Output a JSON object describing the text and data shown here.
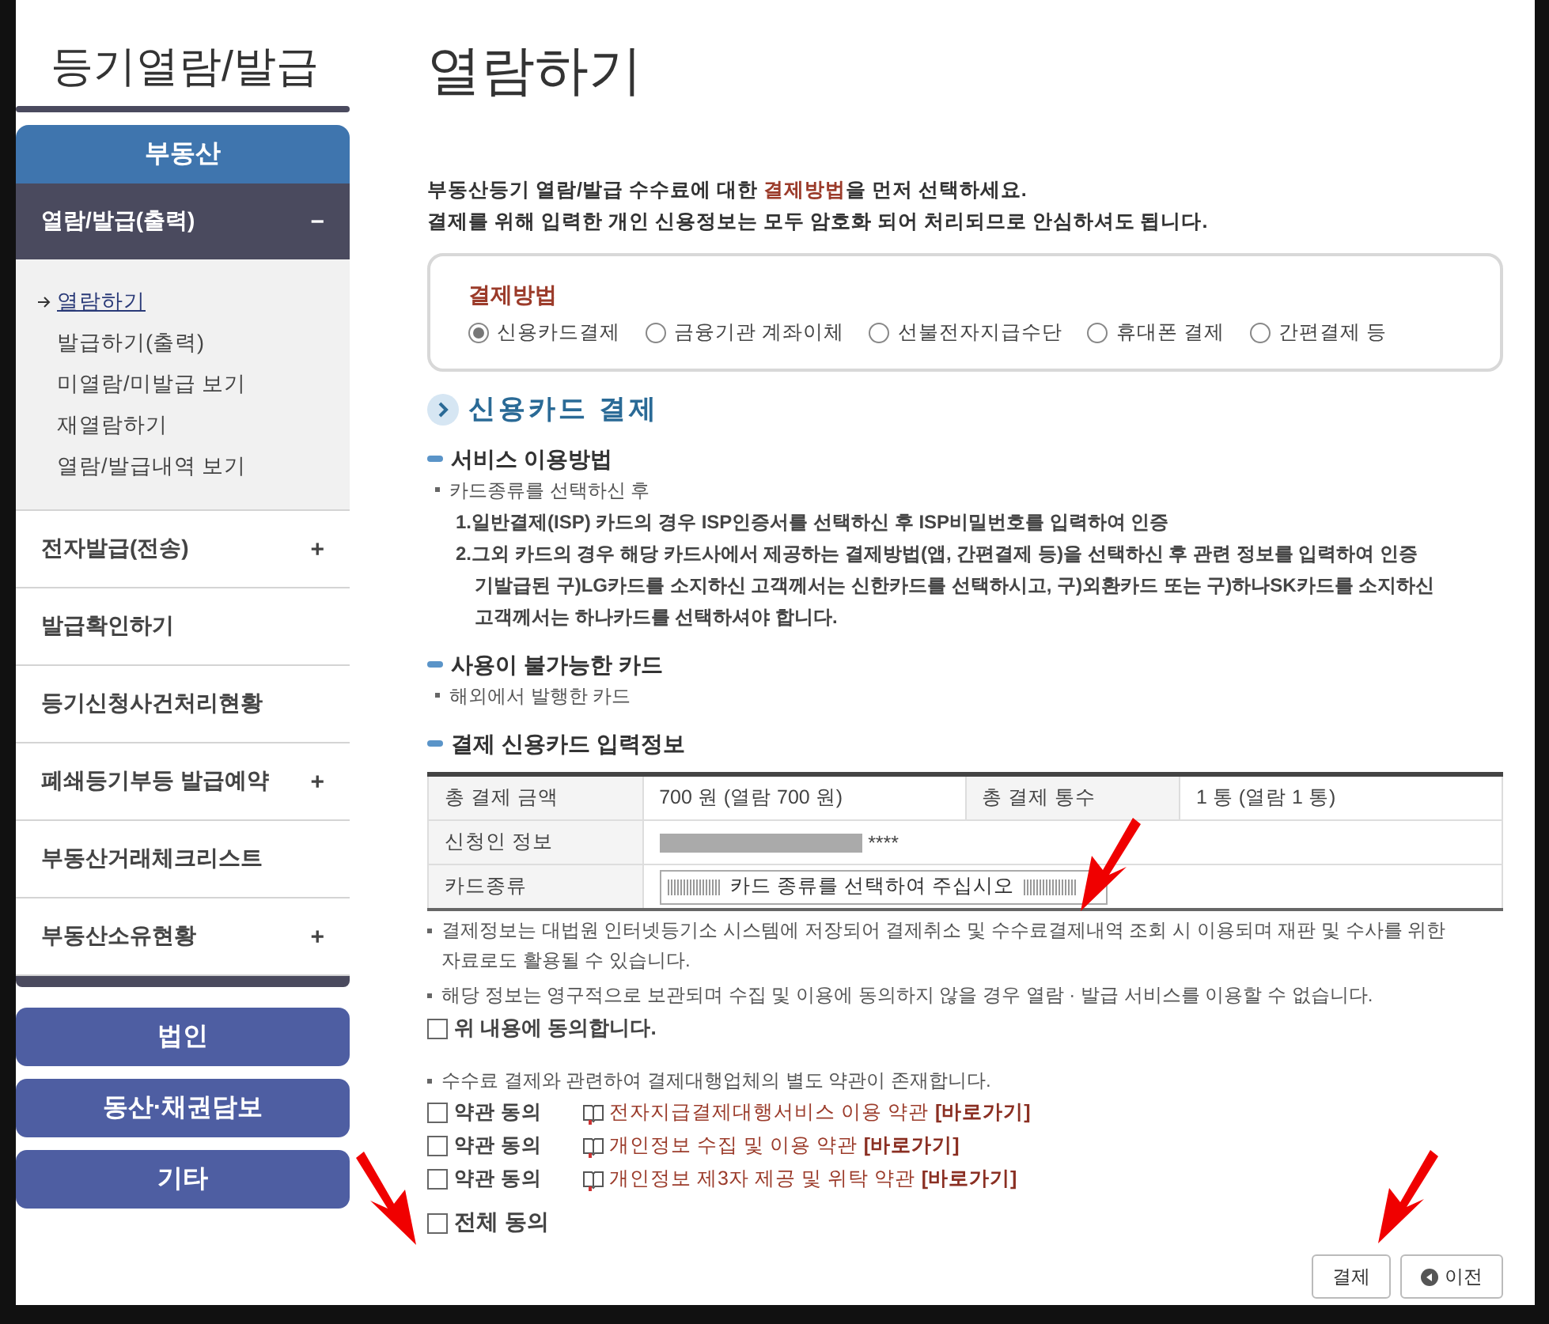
{
  "sidebar": {
    "title": "등기열람/발급",
    "section": "부동산",
    "items": [
      {
        "label": "열람/발급(출력)",
        "toggle": "−",
        "expanded": true,
        "children": [
          {
            "label": "열람하기",
            "selected": true
          },
          {
            "label": "발급하기(출력)",
            "selected": false
          },
          {
            "label": "미열람/미발급 보기",
            "selected": false
          },
          {
            "label": "재열람하기",
            "selected": false
          },
          {
            "label": "열람/발급내역 보기",
            "selected": false
          }
        ]
      },
      {
        "label": "전자발급(전송)",
        "toggle": "+",
        "expanded": false
      },
      {
        "label": "발급확인하기"
      },
      {
        "label": "등기신청사건처리현황"
      },
      {
        "label": "폐쇄등기부등 발급예약",
        "toggle": "+",
        "expanded": false
      },
      {
        "label": "부동산거래체크리스트"
      },
      {
        "label": "부동산소유현황",
        "toggle": "+",
        "expanded": false
      }
    ],
    "other_sections": [
      "법인",
      "동산·채권담보",
      "기타"
    ]
  },
  "page": {
    "title": "열람하기",
    "intro": [
      "부동산등기 열람/발급 수수료에 대한 **결제방법**을 먼저 선택하세요.",
      "결제를 위해 입력한 개인 신용정보는 모두 암호화 되어 처리되므로 안심하셔도 됩니다."
    ]
  },
  "payment_method": {
    "title": "결제방법",
    "options": [
      {
        "label": "신용카드결제",
        "selected": true
      },
      {
        "label": "금융기관 계좌이체",
        "selected": false
      },
      {
        "label": "선불전자지급수단",
        "selected": false
      },
      {
        "label": "휴대폰 결제",
        "selected": false
      },
      {
        "label": "간편결제 등",
        "selected": false
      }
    ]
  },
  "section_title": "신용카드 결제",
  "service": {
    "heading": "서비스 이용방법",
    "bullet": "카드종류를 선택하신 후",
    "steps": [
      "1.일반결제(ISP) 카드의 경우 ISP인증서를 선택하신 후 ISP비밀번호를 입력하여 인증",
      "2.그외 카드의 경우 해당 카드사에서 제공하는 결제방법(앱, 간편결제 등)을 선택하신 후 관련 정보를 입력하여 인증"
    ],
    "note": "기발급된 구)LG카드를 소지하신 고객께서는 신한카드를 선택하시고, 구)외환카드 또는 구)하나SK카드를 소지하신 고객께서는 하나카드를 선택하셔야 합니다."
  },
  "unavailable": {
    "heading": "사용이 불가능한 카드",
    "bullet": "해외에서 발행한 카드"
  },
  "card_info": {
    "heading": "결제 신용카드 입력정보",
    "rows": [
      [
        {
          "kind": "label",
          "text": "총 결제 금액"
        },
        {
          "kind": "value",
          "text": "700 원 (열람 700 원)"
        },
        {
          "kind": "label",
          "text": "총 결제 통수"
        },
        {
          "kind": "value",
          "text": "1 통 (열람 1 통)"
        }
      ],
      [
        {
          "kind": "label",
          "text": "신청인 정보"
        },
        {
          "kind": "redacted",
          "text": "****",
          "colspan": 3
        }
      ],
      [
        {
          "kind": "label",
          "text": "카드종류"
        },
        {
          "kind": "select",
          "value": "카드 종류를 선택하여 주십시오",
          "colspan": 3
        }
      ]
    ]
  },
  "notices": [
    "결제정보는 대법원 인터넷등기소 시스템에 저장되어 결제취소 및 수수료결제내역 조회 시 이용되며 재판 및 수사를 위한 자료로도 활용될 수 있습니다.",
    "해당 정보는 영구적으로 보관되며 수집 및 이용에 동의하지 않을 경우 열람 · 발급 서비스를 이용할 수 없습니다."
  ],
  "agree": {
    "label": "위 내용에 동의합니다.",
    "checked": false
  },
  "terms_notice": "수수료 결제와 관련하여 결제대행업체의 별도 약관이 존재합니다.",
  "terms": [
    {
      "label": "약관 동의",
      "checked": false,
      "title": "전자지급결제대행서비스 이용 약관",
      "link": "[바로가기]"
    },
    {
      "label": "약관 동의",
      "checked": false,
      "title": "개인정보 수집 및 이용 약관",
      "link": "[바로가기]"
    },
    {
      "label": "약관 동의",
      "checked": false,
      "title": "개인정보 제3자 제공 및 위탁 약관",
      "link": "[바로가기]"
    }
  ],
  "all_agree": {
    "label": "전체 동의",
    "checked": false
  },
  "buttons": [
    {
      "kind": "primary",
      "label": "결제"
    },
    {
      "kind": "back",
      "label": "이전"
    }
  ]
}
